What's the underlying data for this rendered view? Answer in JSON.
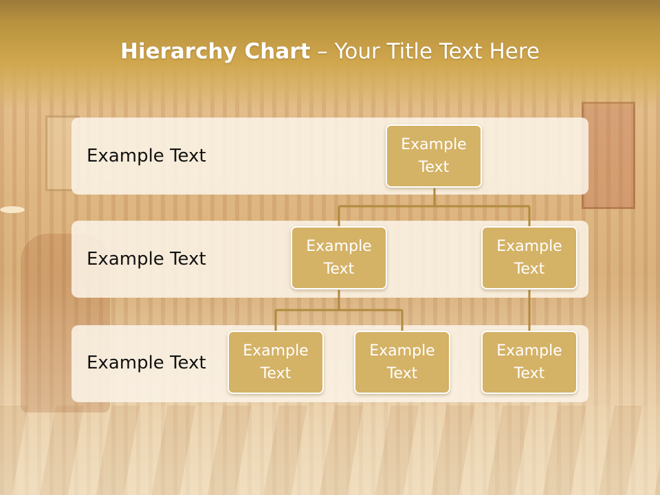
{
  "slide": {
    "title_bold": "Hierarchy Chart",
    "title_rest": " – Your Title Text Here"
  },
  "rows": [
    {
      "label": "Example Text"
    },
    {
      "label": "Example Text"
    },
    {
      "label": "Example Text"
    }
  ],
  "nodes": {
    "root": "Example\nText",
    "level2_left": "Example\nText",
    "level2_right": "Example\nText",
    "level3_a": "Example\nText",
    "level3_b": "Example\nText",
    "level3_c": "Example\nText"
  },
  "colors": {
    "node_fill": "#d4b266",
    "node_border": "#ffffff",
    "connector": "#b08a3e",
    "band": "#faf3e6",
    "header": "#c9a048"
  }
}
